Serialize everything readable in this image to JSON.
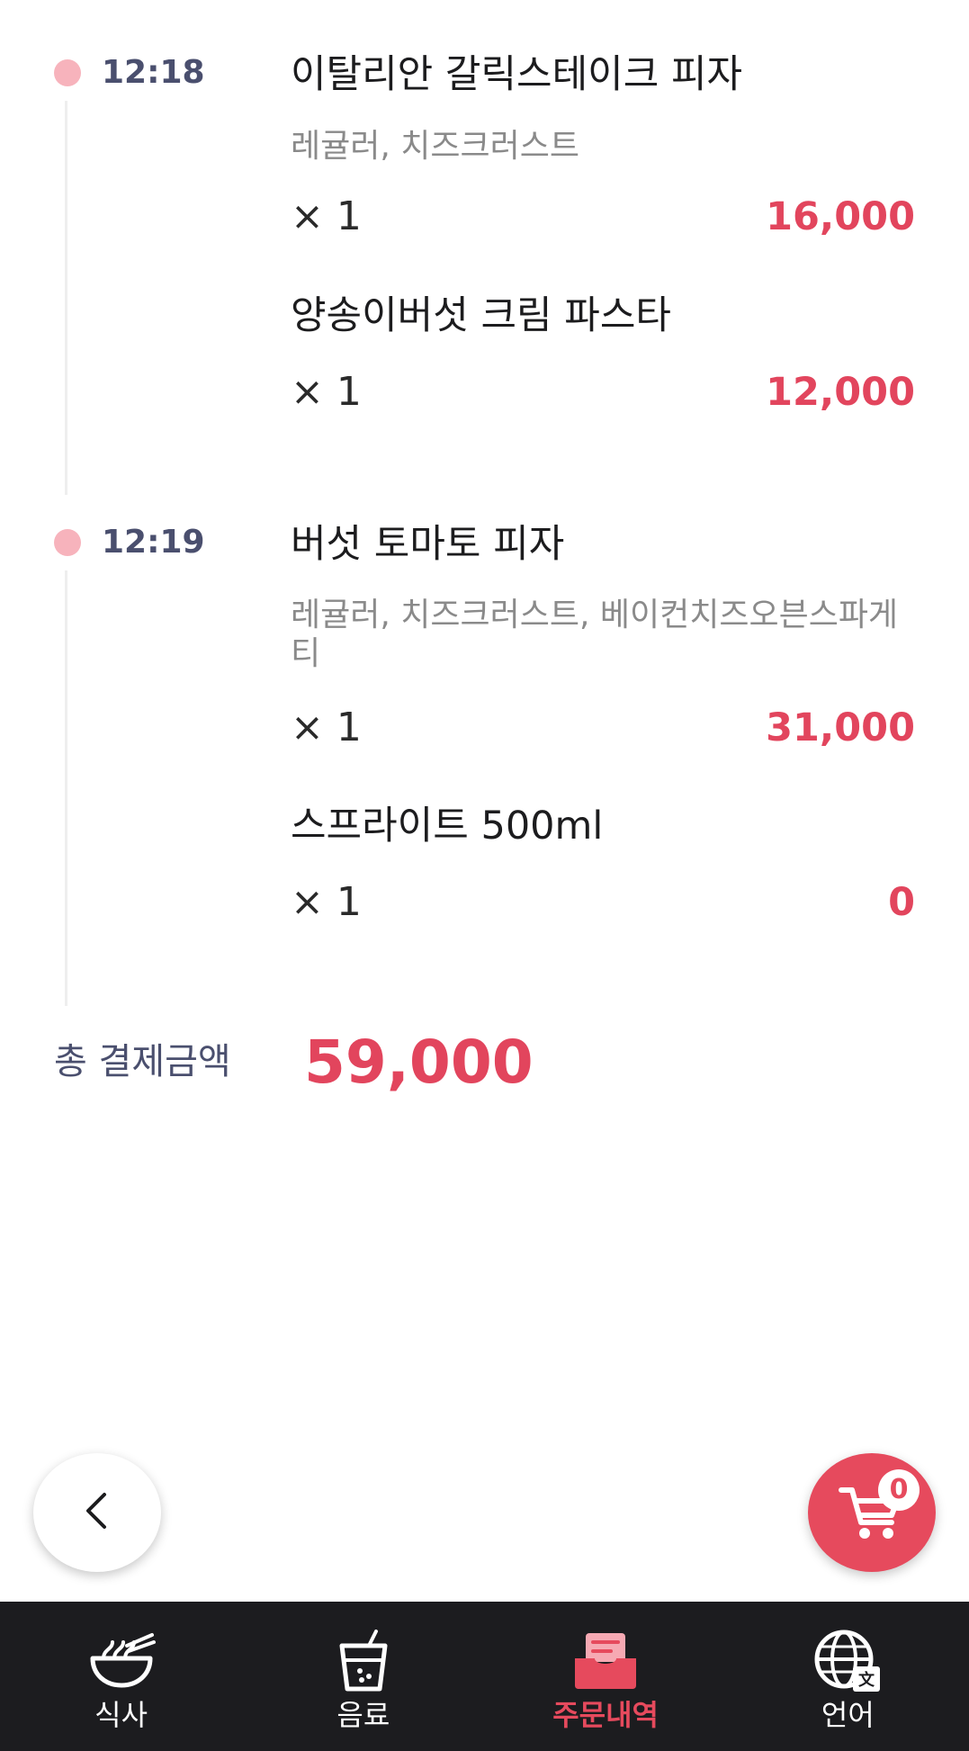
{
  "orders": [
    {
      "time": "12:18",
      "items": [
        {
          "name": "이탈리안 갈릭스테이크 피자",
          "options": "레귤러, 치즈크러스트",
          "qty": "× 1",
          "price": "16,000"
        },
        {
          "name": "양송이버섯 크림 파스타",
          "options": "",
          "qty": "× 1",
          "price": "12,000"
        }
      ]
    },
    {
      "time": "12:19",
      "items": [
        {
          "name": "버섯 토마토 피자",
          "options": "레귤러, 치즈크러스트, 베이컨치즈오븐스파게티",
          "qty": "× 1",
          "price": "31,000"
        },
        {
          "name": "스프라이트 500ml",
          "options": "",
          "qty": "× 1",
          "price": "0"
        }
      ]
    }
  ],
  "total": {
    "label": "총 결제금액",
    "value": "59,000"
  },
  "cart": {
    "count": "0",
    "icon": "cart-icon"
  },
  "back": {
    "icon": "chevron-left-icon"
  },
  "nav": [
    {
      "label": "식사",
      "icon": "noodle-bowl-icon",
      "active": false
    },
    {
      "label": "음료",
      "icon": "drink-cup-icon",
      "active": false
    },
    {
      "label": "주문내역",
      "icon": "order-tray-icon",
      "active": true
    },
    {
      "label": "언어",
      "icon": "globe-language-icon",
      "active": false
    }
  ],
  "colors": {
    "accent": "#e64a5d",
    "price": "#e2455d",
    "dot": "#f7b3bc",
    "nav_bg": "#1c1c1f"
  }
}
